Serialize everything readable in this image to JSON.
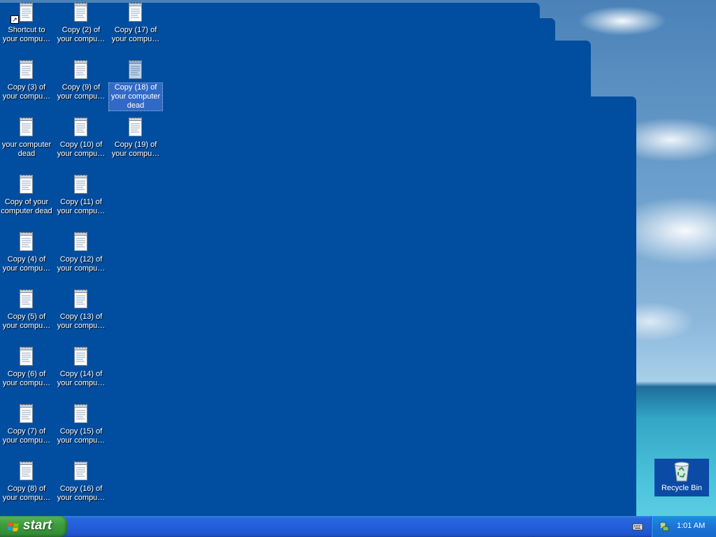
{
  "desktop": {
    "icons": [
      {
        "label": "Shortcut to your compu…",
        "icon": "notepad-shortcut-icon",
        "selected": false
      },
      {
        "label": "Copy (2) of your compu…",
        "icon": "notepad-file-icon",
        "selected": false
      },
      {
        "label": "Copy (17) of your compu…",
        "icon": "notepad-file-icon",
        "selected": false
      },
      {
        "label": "Copy (3) of your compu…",
        "icon": "notepad-file-icon",
        "selected": false
      },
      {
        "label": "Copy (9) of your compu…",
        "icon": "notepad-file-icon",
        "selected": false
      },
      {
        "label": "Copy (18) of your computer dead",
        "icon": "notepad-file-icon",
        "selected": true
      },
      {
        "label": "your computer dead",
        "icon": "notepad-file-icon",
        "selected": false
      },
      {
        "label": "Copy (10) of your compu…",
        "icon": "notepad-file-icon",
        "selected": false
      },
      {
        "label": "Copy (19) of your compu…",
        "icon": "notepad-file-icon",
        "selected": false
      },
      {
        "label": "Copy of your computer dead",
        "icon": "notepad-file-icon",
        "selected": false
      },
      {
        "label": "Copy (11) of your compu…",
        "icon": "notepad-file-icon",
        "selected": false
      },
      {
        "label": "Copy (4) of your compu…",
        "icon": "notepad-file-icon",
        "selected": false
      },
      {
        "label": "Copy (12) of your compu…",
        "icon": "notepad-file-icon",
        "selected": false
      },
      {
        "label": "Copy (5) of your compu…",
        "icon": "notepad-file-icon",
        "selected": false
      },
      {
        "label": "Copy (13) of your compu…",
        "icon": "notepad-file-icon",
        "selected": false
      },
      {
        "label": "Copy (6) of your compu…",
        "icon": "notepad-file-icon",
        "selected": false
      },
      {
        "label": "Copy (14) of your compu…",
        "icon": "notepad-file-icon",
        "selected": false
      },
      {
        "label": "Copy (7) of your compu…",
        "icon": "notepad-file-icon",
        "selected": false
      },
      {
        "label": "Copy (15) of your compu…",
        "icon": "notepad-file-icon",
        "selected": false
      },
      {
        "label": "Copy (8) of your compu…",
        "icon": "notepad-file-icon",
        "selected": false
      },
      {
        "label": "Copy (16) of your compu…",
        "icon": "notepad-file-icon",
        "selected": false
      }
    ],
    "recycle_bin": {
      "label": "Recycle Bin",
      "icon": "recycle-bin-icon"
    }
  },
  "taskbar": {
    "start_label": "start",
    "start_icon": "windows-flag-icon",
    "tray": {
      "icons": [
        "keyboard-icon",
        "network-icon"
      ],
      "clock": "1:01 AM"
    }
  },
  "colors": {
    "window_blue": "#014d9f",
    "taskbar_blue": "#245edb",
    "start_green": "#3d9d3f",
    "selection_blue": "#3169c6"
  }
}
